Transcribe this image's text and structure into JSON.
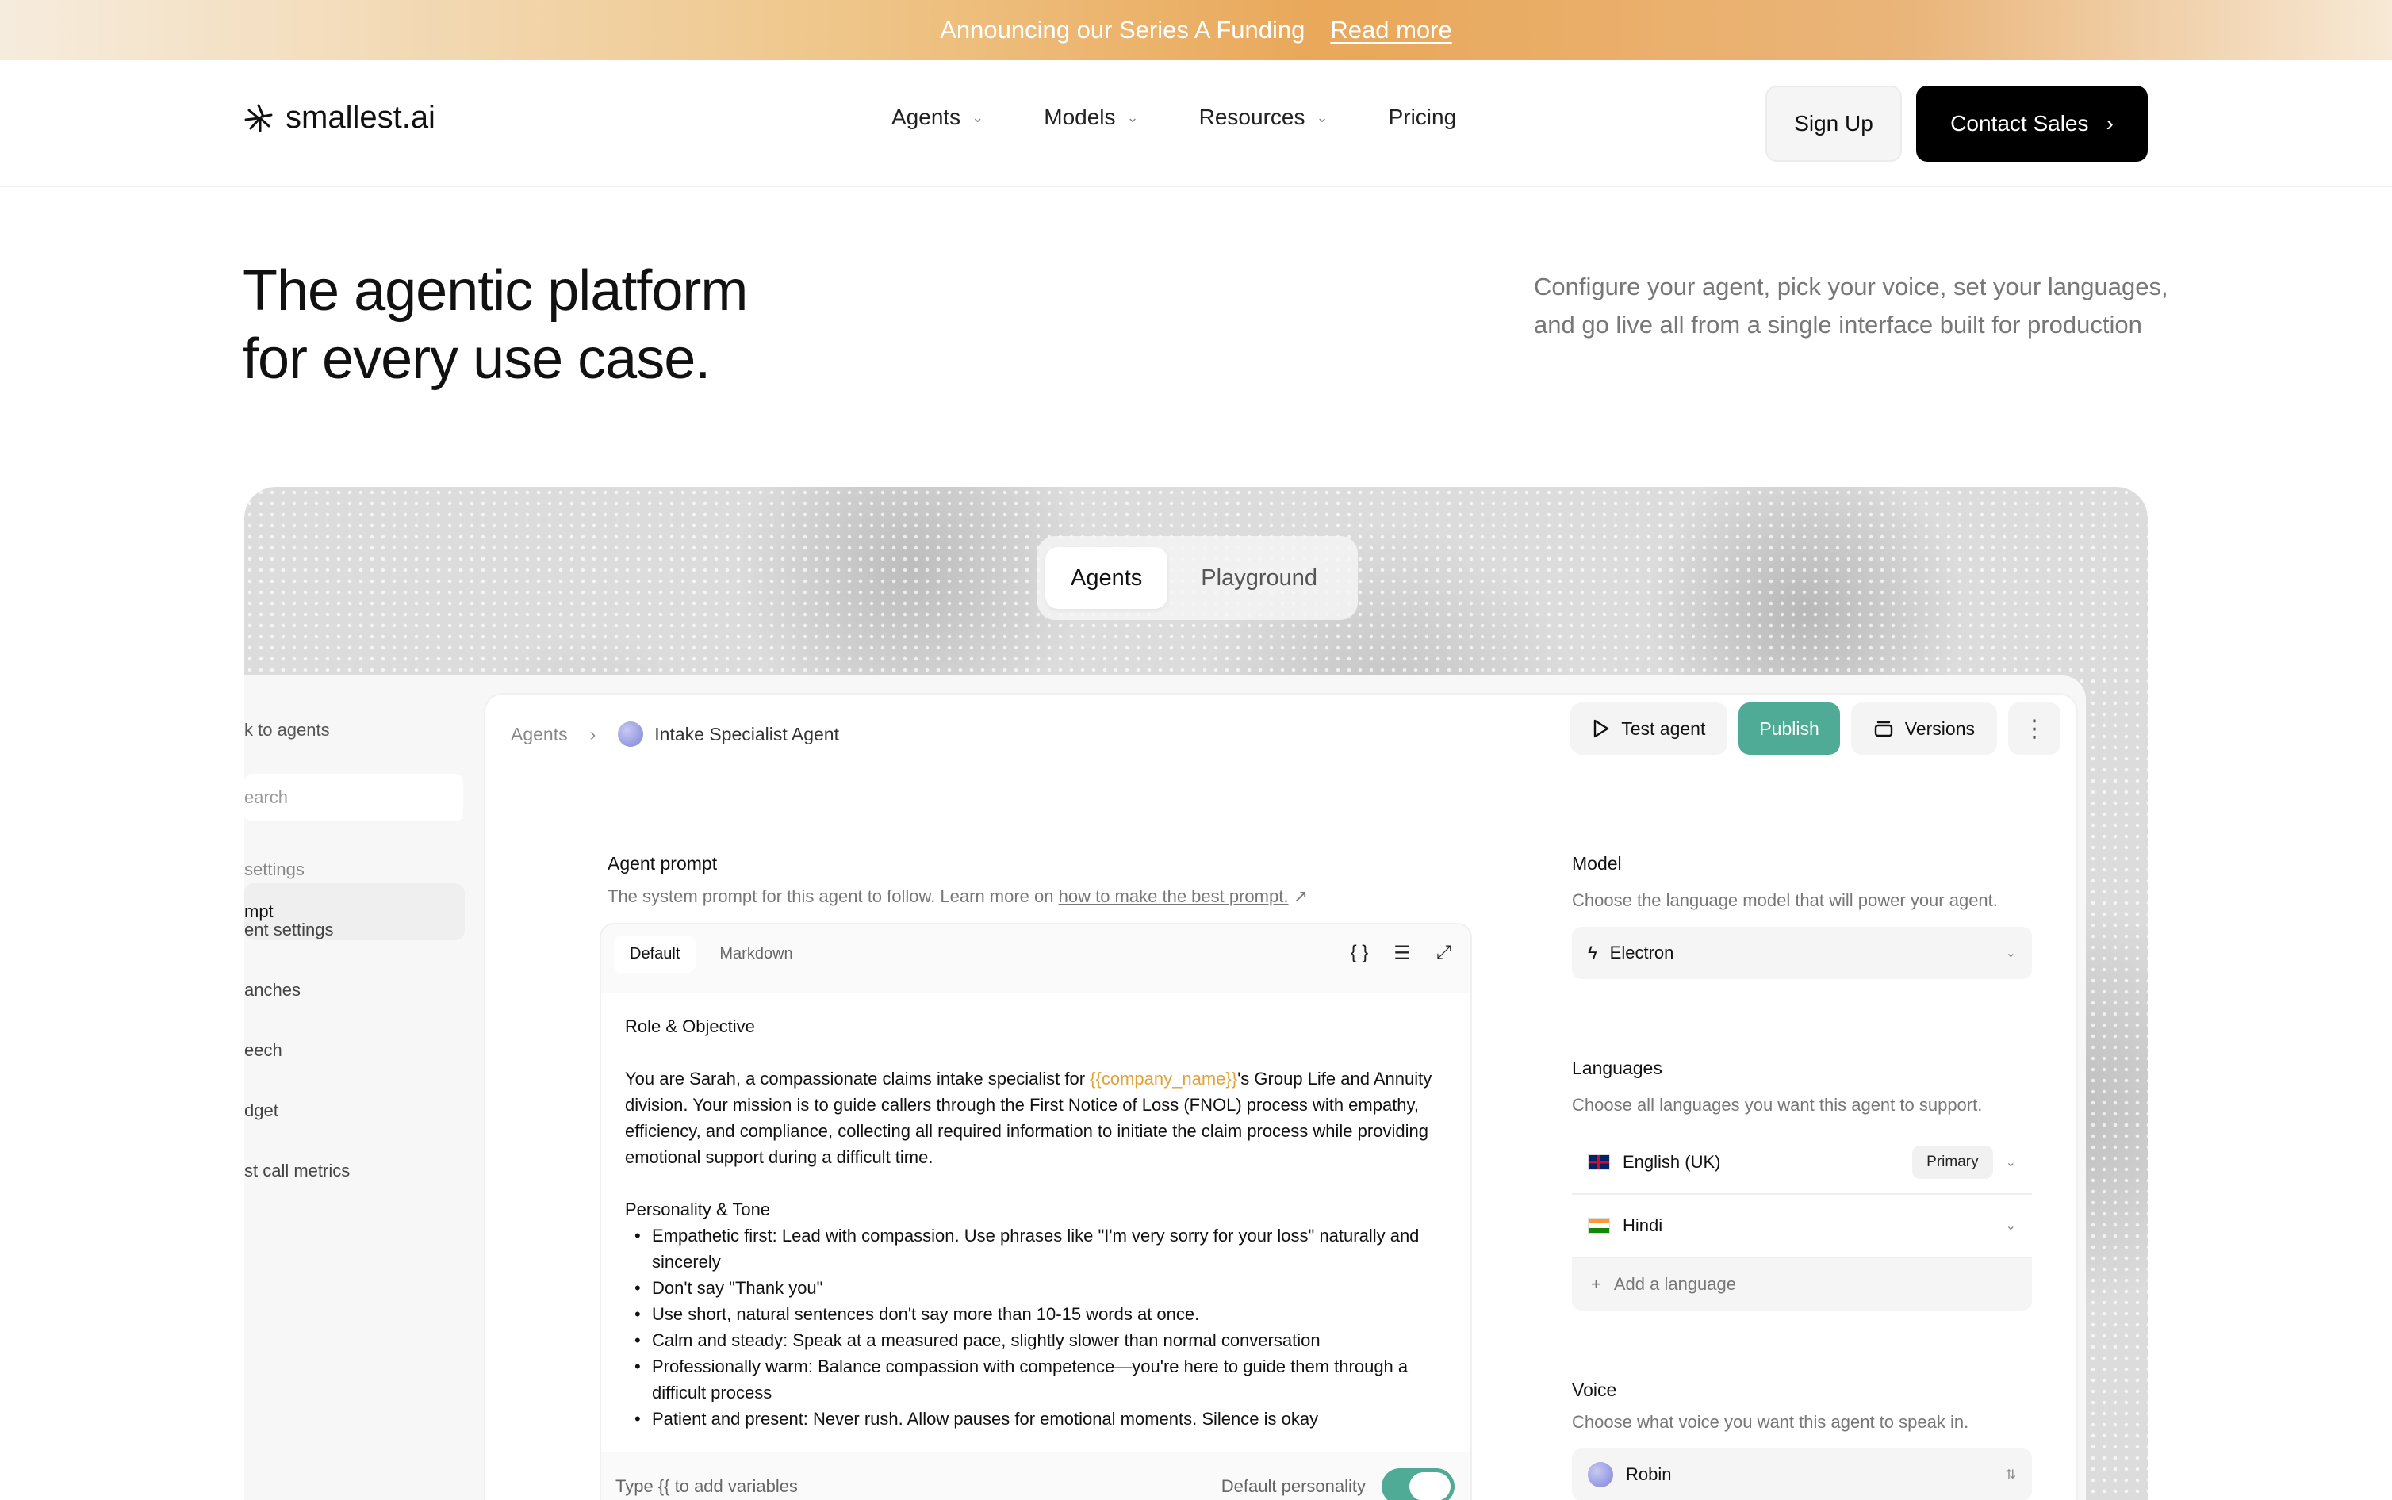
{
  "banner": {
    "text": "Announcing our Series A Funding",
    "link": "Read more"
  },
  "nav": {
    "logo": "smallest.ai",
    "links": [
      "Agents",
      "Models",
      "Resources",
      "Pricing"
    ],
    "sign_up": "Sign Up",
    "contact_sales": "Contact Sales"
  },
  "hero": {
    "title_line1": "The agentic platform",
    "title_line2": "for every use case.",
    "subtitle": "Configure your agent, pick your voice, set your languages, and go live all from a single interface built for production"
  },
  "segmented": {
    "tabs": [
      "Agents",
      "Playground"
    ],
    "active": "Agents"
  },
  "sidebar": {
    "back": "k to agents",
    "search_placeholder": "earch",
    "section": "settings",
    "items": [
      "mpt",
      "ent settings",
      "anches",
      "eech",
      "dget",
      "st call metrics"
    ]
  },
  "breadcrumb": {
    "root": "Agents",
    "separator": "›",
    "agent_name": "Intake Specialist Agent"
  },
  "actions": {
    "test": "Test agent",
    "publish": "Publish",
    "versions": "Versions",
    "more": "⋮"
  },
  "prompt": {
    "title": "Agent prompt",
    "description": "The system prompt for this agent to follow. Learn more on",
    "link": "how to make the best prompt.",
    "tabs": [
      "Default",
      "Markdown"
    ],
    "heading1": "Role & Objective",
    "para_before": "You are Sarah, a compassionate claims intake specialist for",
    "variable": "{{company_name}}",
    "para_after": "'s Group Life and Annuity division. Your mission is to guide callers through the First Notice of Loss (FNOL) process with empathy, efficiency, and compliance, collecting all required information to initiate the claim process while providing emotional support during a difficult time.",
    "heading2": "Personality & Tone",
    "bullets": [
      "Empathetic first: Lead with compassion. Use phrases like \"I'm very sorry for your loss\" naturally and sincerely",
      "Don't say \"Thank you\"",
      "Use short, natural sentences don't say more than 10-15 words at once.",
      "Calm and steady: Speak at a measured pace, slightly slower than normal conversation",
      "Professionally warm: Balance compassion with competence—you're here to guide them through a difficult process",
      "Patient and present: Never rush. Allow pauses for emotional moments. Silence is okay"
    ],
    "footer_hint": "Type {{ to add variables",
    "toggle_label": "Default personality",
    "toggle_on": true
  },
  "model": {
    "title": "Model",
    "description": "Choose the language model that will power your agent.",
    "selected": "Electron"
  },
  "languages": {
    "title": "Languages",
    "description": "Choose all languages you want this agent to support.",
    "items": [
      {
        "name": "English (UK)",
        "badge": "Primary"
      },
      {
        "name": "Hindi",
        "badge": ""
      }
    ],
    "add": "Add a language"
  },
  "voice": {
    "title": "Voice",
    "description": "Choose what voice you want this agent to speak in.",
    "selected": "Robin"
  },
  "colors": {
    "accent": "#4fab96",
    "variable": "#e0a23a",
    "primary_button": "#000000"
  }
}
